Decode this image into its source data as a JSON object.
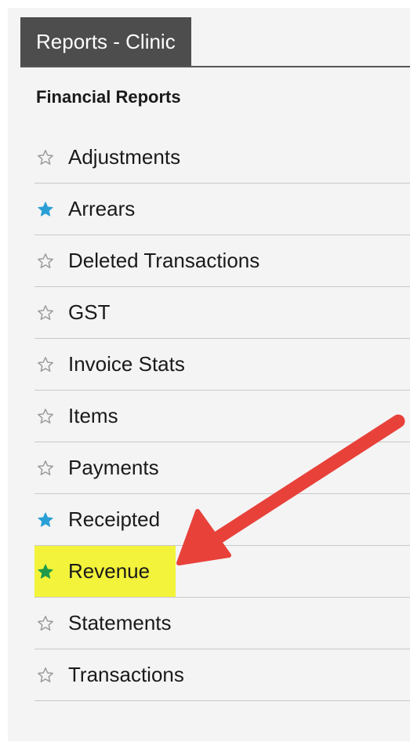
{
  "tab": {
    "label": "Reports - Clinic"
  },
  "section": {
    "title": "Financial Reports"
  },
  "items": [
    {
      "label": "Adjustments",
      "star": "outline"
    },
    {
      "label": "Arrears",
      "star": "blue"
    },
    {
      "label": "Deleted Transactions",
      "star": "outline"
    },
    {
      "label": "GST",
      "star": "outline"
    },
    {
      "label": "Invoice Stats",
      "star": "outline"
    },
    {
      "label": "Items",
      "star": "outline"
    },
    {
      "label": "Payments",
      "star": "outline"
    },
    {
      "label": "Receipted",
      "star": "blue"
    },
    {
      "label": "Revenue",
      "star": "green",
      "highlighted": true
    },
    {
      "label": "Statements",
      "star": "outline"
    },
    {
      "label": "Transactions",
      "star": "outline"
    }
  ],
  "colors": {
    "tab_bg": "#4d4d4d",
    "star_blue": "#2a9fd6",
    "star_green": "#1f9a4a",
    "star_outline": "#9a9a9a",
    "highlight": "#f3f33b",
    "arrow": "#e8413a"
  },
  "annotation": {
    "icon": "red-arrow-icon",
    "points_to": "Revenue"
  }
}
